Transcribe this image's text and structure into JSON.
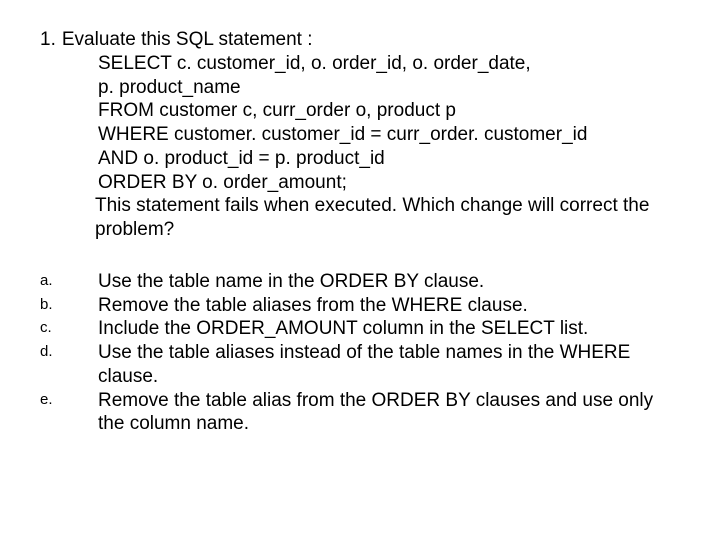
{
  "question": {
    "number": "1.",
    "intro": "Evaluate this SQL statement :",
    "sql_lines": [
      "SELECT c. customer_id, o. order_id, o. order_date,",
      "p. product_name",
      "FROM customer c, curr_order o, product p",
      "WHERE customer. customer_id = curr_order. customer_id",
      "AND o. product_id = p. product_id",
      "ORDER BY o. order_amount;"
    ],
    "followup": "This statement fails when executed. Which change will correct the problem?"
  },
  "options": [
    {
      "letter": "a.",
      "text": "Use the table name in the ORDER BY clause."
    },
    {
      "letter": "b.",
      "text": "Remove the table aliases from the WHERE clause."
    },
    {
      "letter": "c.",
      "text": "Include the ORDER_AMOUNT column in the SELECT list."
    },
    {
      "letter": "d.",
      "text": "Use the table aliases instead of the table names in the WHERE clause."
    },
    {
      "letter": "e.",
      "text": "Remove the table alias from the ORDER BY clauses and use only the column name."
    }
  ]
}
